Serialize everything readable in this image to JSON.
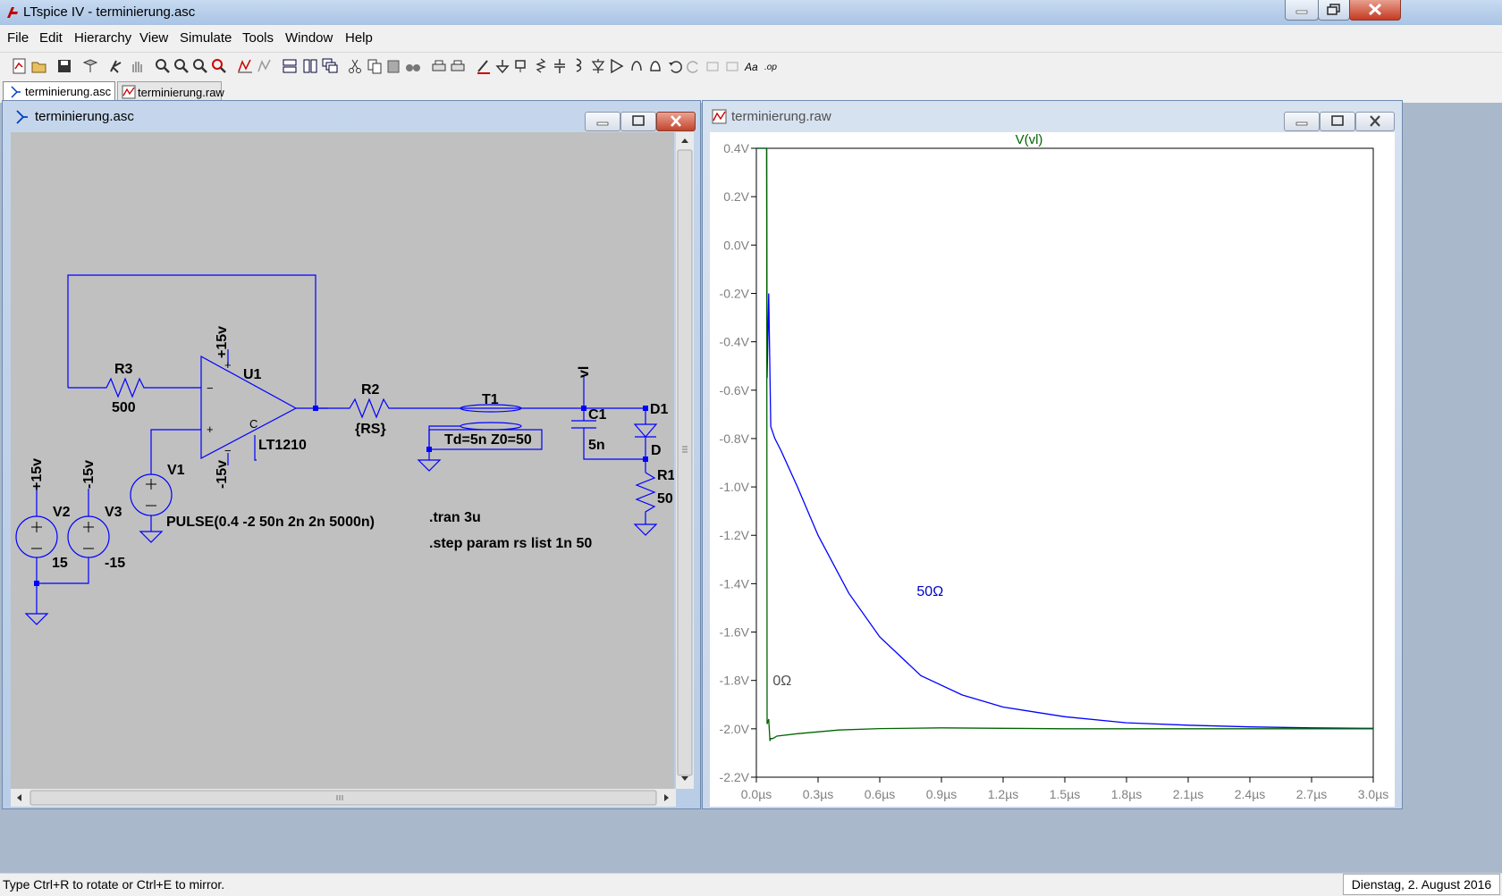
{
  "app": {
    "title": "LTspice IV - terminierung.asc"
  },
  "menu": [
    "File",
    "Edit",
    "Hierarchy",
    "View",
    "Simulate",
    "Tools",
    "Window",
    "Help"
  ],
  "tabs": [
    {
      "label": "terminierung.asc",
      "icon": "schematic-icon"
    },
    {
      "label": "terminierung.raw",
      "icon": "waveform-icon"
    }
  ],
  "schematic": {
    "title": "terminierung.asc",
    "labels": {
      "r3": "R3",
      "r3_val": "500",
      "u1": "U1",
      "u1_part": "LT1210",
      "u1_plus_supply": "+15v",
      "u1_minus_supply": "-15v",
      "u1_plus_pin": "+",
      "u1_minus_pin": "−",
      "u1_c_pin": "C",
      "u1_minus_pin2": "−",
      "r2": "R2",
      "r2_val": "{RS}",
      "t1": "T1",
      "t1_val": "Td=5n Z0=50",
      "vl": "vl",
      "c1": "C1",
      "c1_val": "5n",
      "d1": "D1",
      "d1_val": "D",
      "r1": "R1",
      "r1_val": "50",
      "v1": "V1",
      "v1_val": "PULSE(0.4 -2 50n 2n 2n 5000n)",
      "v2": "V2",
      "v2_val": "15",
      "v2_net": "+15v",
      "v3": "V3",
      "v3_val": "-15",
      "v3_net": "-15v",
      "tran": ".tran 3u",
      "step": ".step param rs list 1n 50"
    }
  },
  "waveform": {
    "title": "terminierung.raw",
    "chart_data": {
      "type": "line",
      "title": "V(vl)",
      "xlabel": "",
      "ylabel": "",
      "xlim": [
        0,
        3.0
      ],
      "ylim": [
        -2.2,
        0.4
      ],
      "x_unit": "µs",
      "y_unit": "V",
      "x_ticks": [
        "0.0µs",
        "0.3µs",
        "0.6µs",
        "0.9µs",
        "1.2µs",
        "1.5µs",
        "1.8µs",
        "2.1µs",
        "2.4µs",
        "2.7µs",
        "3.0µs"
      ],
      "y_ticks": [
        "0.4V",
        "0.2V",
        "0.0V",
        "-0.2V",
        "-0.4V",
        "-0.6V",
        "-0.8V",
        "-1.0V",
        "-1.2V",
        "-1.4V",
        "-1.6V",
        "-1.8V",
        "-2.0V",
        "-2.2V"
      ],
      "series": [
        {
          "name": "50Ω",
          "color": "#0000ff",
          "x": [
            0,
            0.05,
            0.052,
            0.06,
            0.07,
            0.09,
            0.12,
            0.2,
            0.3,
            0.45,
            0.6,
            0.8,
            1.0,
            1.2,
            1.5,
            1.8,
            2.1,
            2.4,
            2.7,
            3.0
          ],
          "y": [
            0.4,
            0.4,
            -0.55,
            -0.2,
            -0.75,
            -0.8,
            -0.85,
            -1.0,
            -1.2,
            -1.44,
            -1.62,
            -1.78,
            -1.86,
            -1.91,
            -1.95,
            -1.975,
            -1.985,
            -1.992,
            -1.996,
            -1.998
          ]
        },
        {
          "name": "0Ω",
          "color": "#006400",
          "x": [
            0,
            0.05,
            0.052,
            0.06,
            0.066,
            0.07,
            0.08,
            0.1,
            0.2,
            0.4,
            0.6,
            0.9,
            1.2,
            1.5,
            2.0,
            2.5,
            3.0
          ],
          "y": [
            0.4,
            0.4,
            -1.98,
            -1.96,
            -2.05,
            -2.04,
            -2.04,
            -2.03,
            -2.02,
            -2.005,
            -1.999,
            -1.996,
            -1.998,
            -2.0,
            -2.0,
            -2.0,
            -2.0
          ]
        }
      ]
    }
  },
  "status": {
    "hint": "Type Ctrl+R to rotate or Ctrl+E to mirror.",
    "date": "Dienstag, 2. August 2016"
  }
}
